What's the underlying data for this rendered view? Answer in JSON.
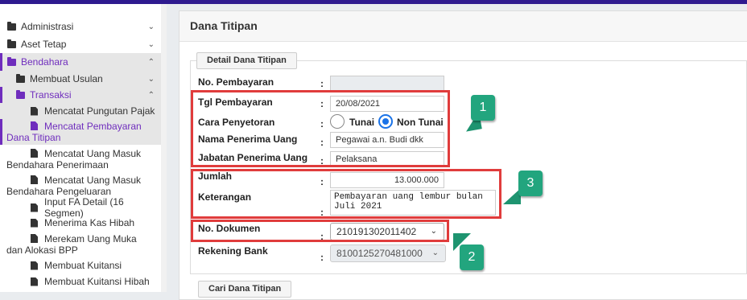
{
  "sidebar": {
    "items": [
      {
        "label": "Administrasi",
        "chevron": "chevron-down"
      },
      {
        "label": "Aset Tetap",
        "chevron": "chevron-down"
      },
      {
        "label": "Bendahara",
        "chevron": "chevron-up"
      },
      {
        "label": "Membuat Usulan",
        "chevron": "chevron-down"
      },
      {
        "label": "Transaksi",
        "chevron": "chevron-up"
      }
    ],
    "subitems": [
      "Mencatat Pungutan Pajak",
      "Mencatat Pembayaran Dana Titipan",
      "Mencatat Uang Masuk Bendahara Penerimaan",
      "Mencatat Uang Masuk Bendahara Pengeluaran",
      "Input FA Detail (16 Segmen)",
      "Menerima Kas Hibah",
      "Merekam Uang Muka dan Alokasi BPP",
      "Membuat Kuitansi",
      "Membuat Kuitansi Hibah"
    ]
  },
  "page": {
    "title": "Dana Titipan"
  },
  "detail": {
    "legend": "Detail Dana Titipan",
    "no_pembayaran_label": "No. Pembayaran",
    "no_pembayaran_value": "",
    "tgl_label": "Tgl Pembayaran",
    "tgl_value": "20/08/2021",
    "cara_label": "Cara Penyetoran",
    "opt_tunai": "Tunai",
    "opt_non_tunai": "Non Tunai",
    "nama_label": "Nama Penerima Uang",
    "nama_value": "Pegawai a.n. Budi dkk",
    "jabatan_label": "Jabatan Penerima Uang",
    "jabatan_value": "Pelaksana",
    "jumlah_label": "Jumlah",
    "jumlah_value": "13.000.000",
    "keterangan_label": "Keterangan",
    "keterangan_value": "Pembayaran uang lembur bulan\nJuli 2021",
    "dokumen_label": "No. Dokumen",
    "dokumen_value": "210191302011402",
    "rekening_label": "Rekening Bank",
    "rekening_value": "8100125270481000",
    "colon": ":"
  },
  "cari": {
    "legend": "Cari Dana Titipan"
  },
  "callouts": {
    "one": "1",
    "two": "2",
    "three": "3"
  },
  "colors": {
    "accent": "#6f2dbd",
    "highlight_box": "#e03c3c",
    "callout": "#22a57e",
    "radio": "#1a73e8"
  }
}
